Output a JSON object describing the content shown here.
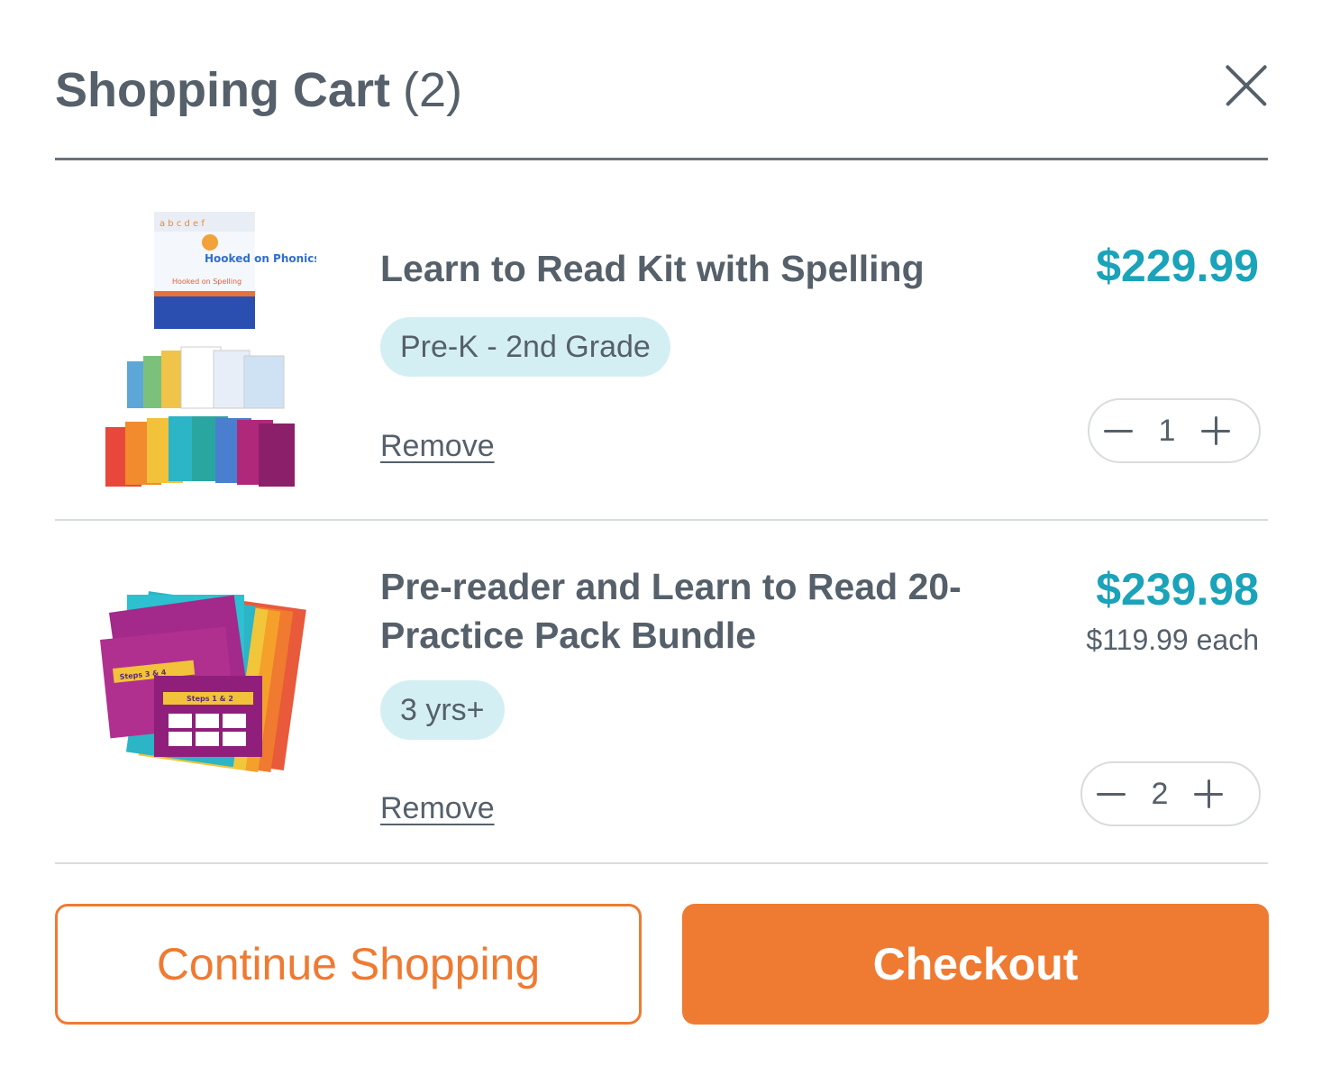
{
  "header": {
    "title": "Shopping Cart",
    "count": "(2)"
  },
  "items": [
    {
      "name": "Learn to Read Kit with Spelling",
      "badge": "Pre-K - 2nd Grade",
      "price": "$229.99",
      "each": "",
      "quantity": "1",
      "remove_label": "Remove",
      "image_text": {
        "brand": "Hooked on Phonics",
        "sub": "Hooked on Spelling"
      }
    },
    {
      "name": "Pre-reader and Learn to Read 20-Practice Pack Bundle",
      "badge": "3 yrs+",
      "price": "$239.98",
      "each": "$119.99 each",
      "quantity": "2",
      "remove_label": "Remove",
      "image_text": {
        "step_a": "Steps 3 & 4",
        "step_b": "Steps 1 & 2"
      }
    }
  ],
  "footer": {
    "continue_label": "Continue Shopping",
    "checkout_label": "Checkout"
  },
  "colors": {
    "accent": "#ef7a32",
    "price": "#1aa3b9",
    "badge_bg": "#d4eff3",
    "text": "#55606a"
  }
}
